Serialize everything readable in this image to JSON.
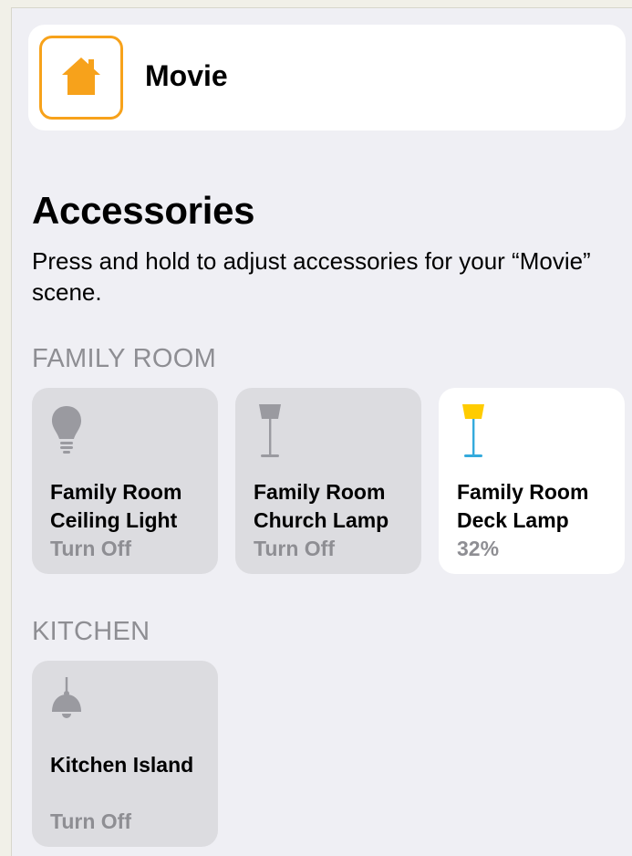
{
  "scene": {
    "name": "Movie",
    "icon": "house-icon",
    "accent_color": "#f7a21b"
  },
  "section": {
    "title": "Accessories",
    "description": "Press and hold to adjust accessories for your “Movie” scene."
  },
  "groups": [
    {
      "label": "FAMILY ROOM",
      "accessories": [
        {
          "name": "Family Room Ceiling Light",
          "status": "Turn Off",
          "icon": "light-bulb-icon",
          "on": false
        },
        {
          "name": "Family Room Church Lamp",
          "status": "Turn Off",
          "icon": "floor-lamp-icon",
          "on": false
        },
        {
          "name": "Family Room Deck Lamp",
          "status": "32%",
          "icon": "floor-lamp-icon",
          "on": true,
          "lamp_color": "#ffcc00"
        }
      ]
    },
    {
      "label": "KITCHEN",
      "accessories": [
        {
          "name": "Kitchen Island",
          "status": "Turn Off",
          "icon": "pendant-lamp-icon",
          "on": false
        }
      ]
    }
  ]
}
